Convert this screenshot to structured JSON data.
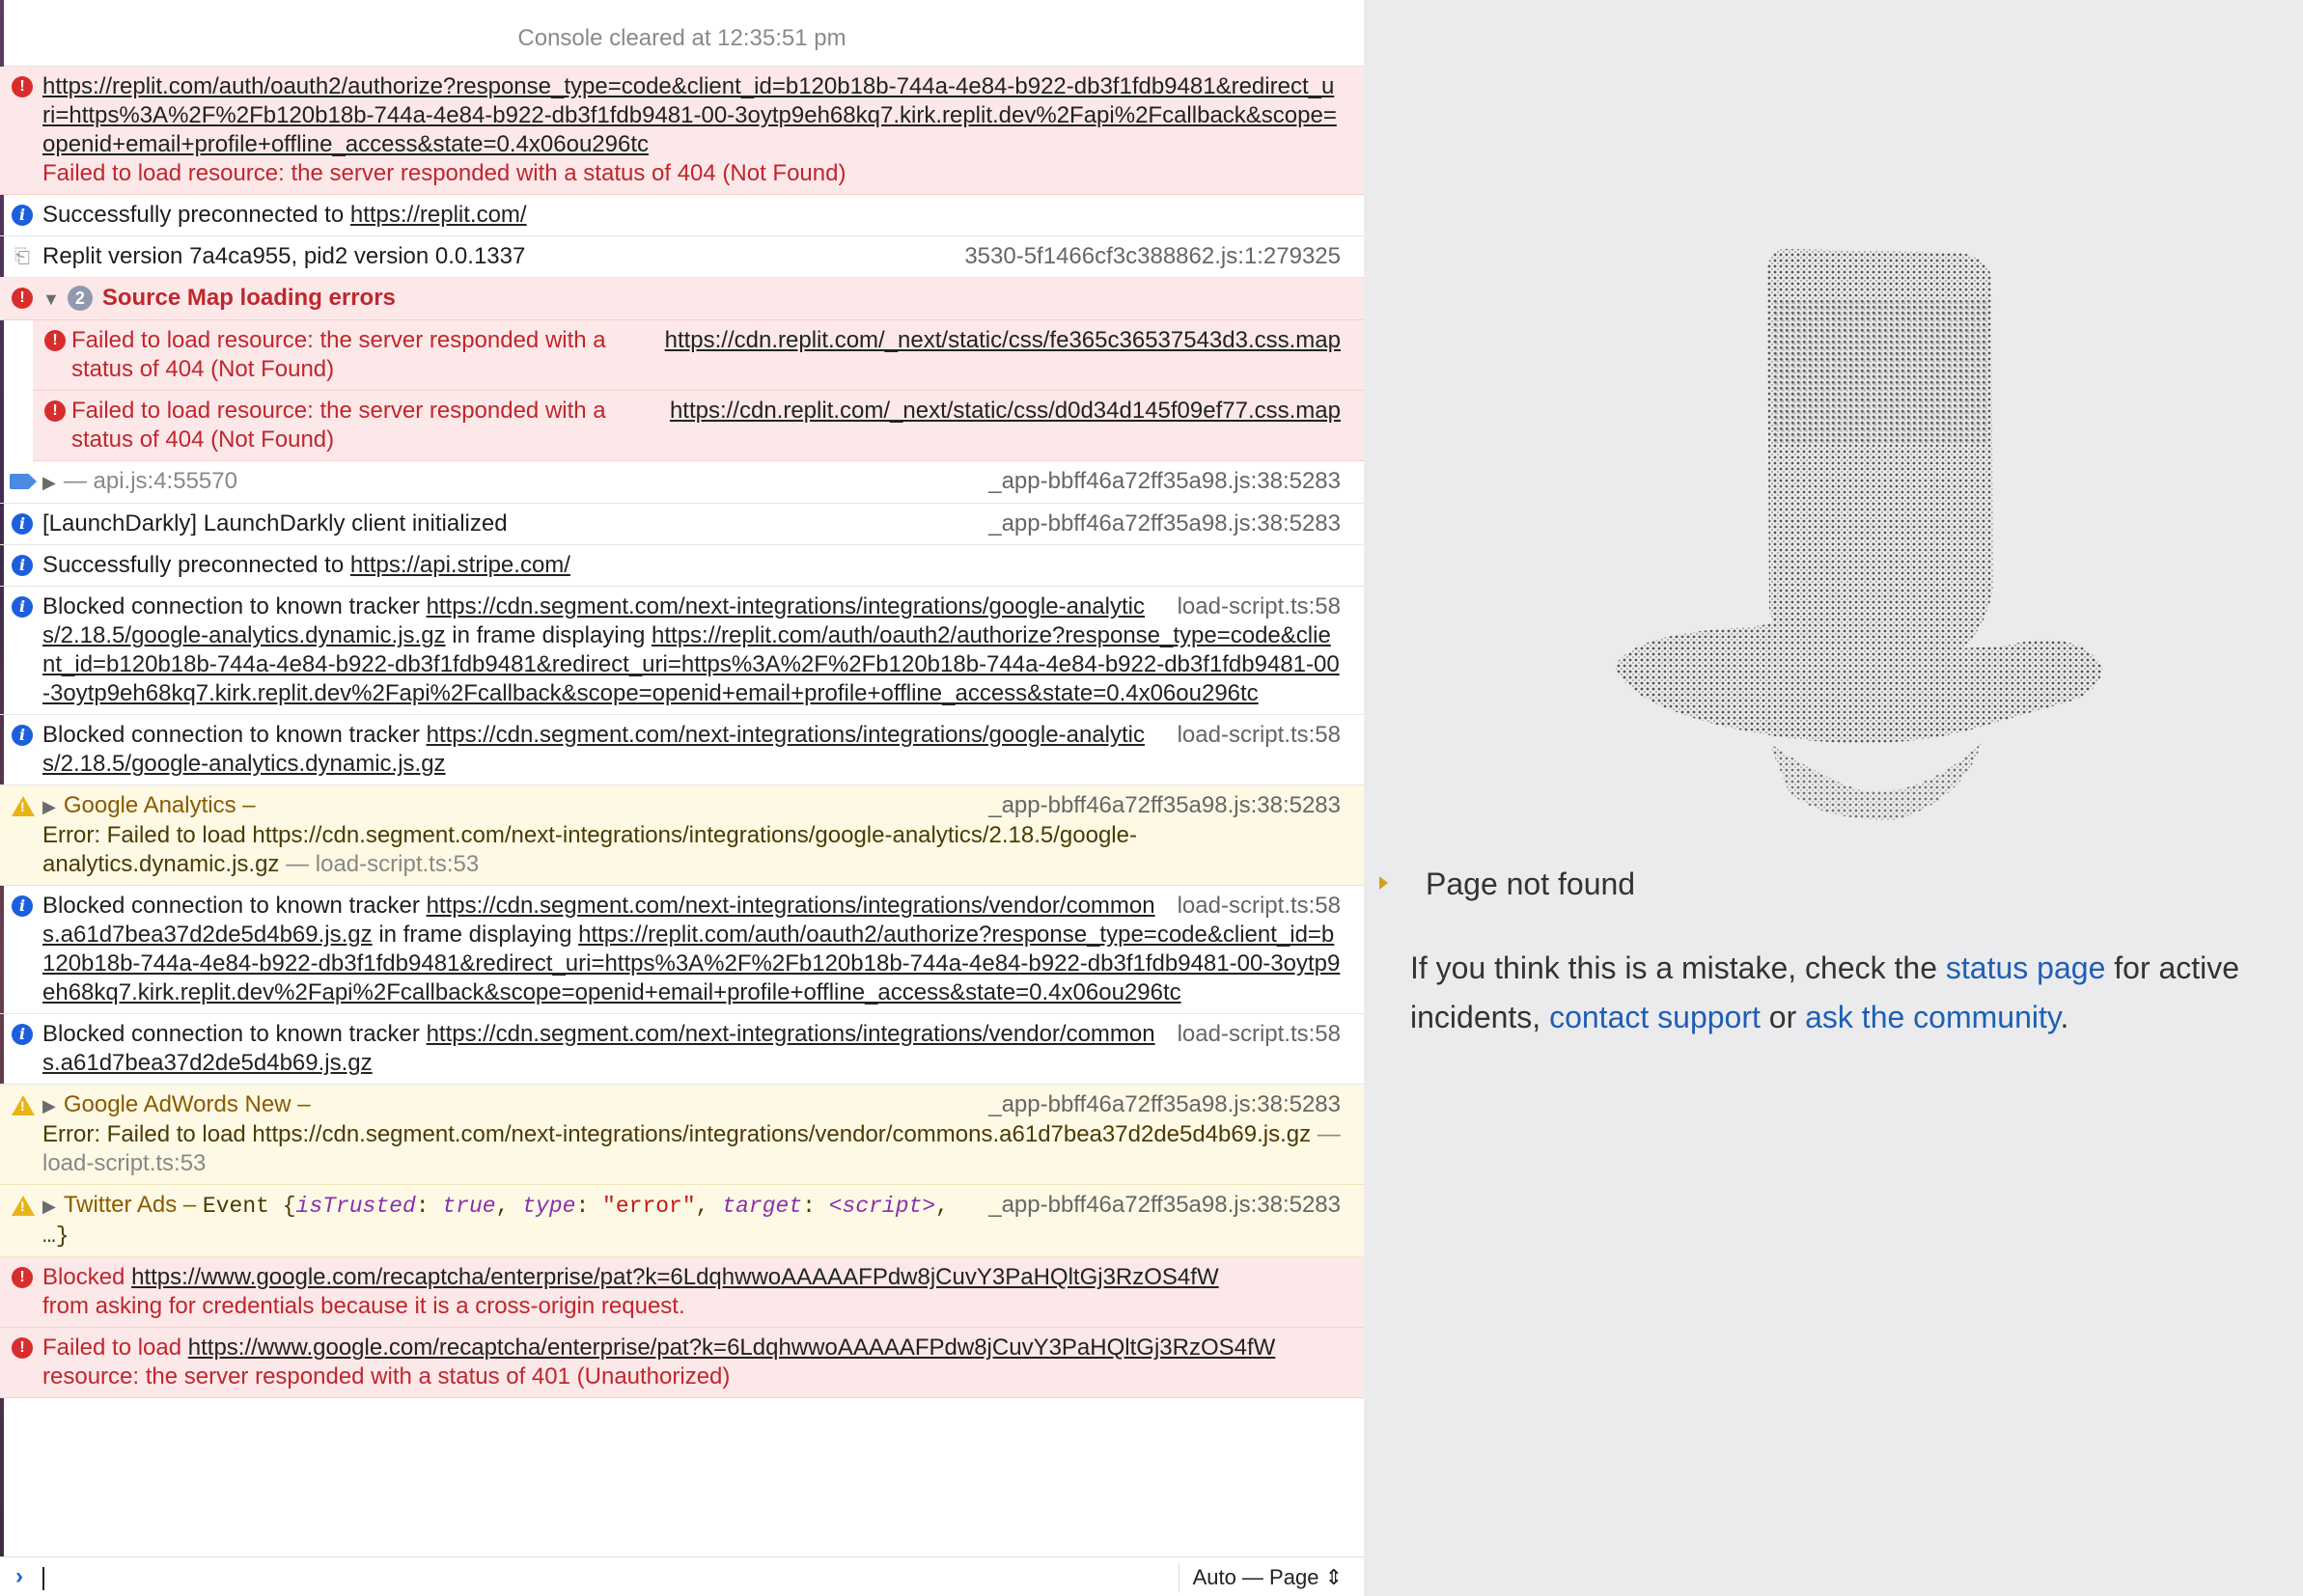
{
  "console": {
    "cleared": "Console cleared at 12:35:51 pm",
    "rows": [
      {
        "link": "https://replit.com/auth/oauth2/authorize?response_type=code&client_id=b120b18b-744a-4e84-b922-db3f1fdb9481&redirect_uri=https%3A%2F%2Fb120b18b-744a-4e84-b922-db3f1fdb9481-00-3oytp9eh68kq7.kirk.replit.dev%2Fapi%2Fcallback&scope=openid+email+profile+offline_access&state=0.4x06ou296tc",
        "msg": "Failed to load resource: the server responded with a status of 404 (Not Found)"
      },
      {
        "text": "Successfully preconnected to",
        "link": "https://replit.com/"
      },
      {
        "text": "Replit version 7a4ca955, pid2 version 0.0.1337",
        "source": "3530-5f1466cf3c388862.js:1:279325"
      },
      {
        "count": "2",
        "title": "Source Map loading errors"
      },
      {
        "msg": "Failed to load resource: the server responded with a status of 404 (Not Found)",
        "link": "https://cdn.replit.com/_next/static/css/fe365c36537543d3.css.map"
      },
      {
        "msg": "Failed to load resource: the server responded with a status of 404 (Not Found)",
        "link": "https://cdn.replit.com/_next/static/css/d0d34d145f09ef77.css.map"
      },
      {
        "text": "— api.js:4:55570",
        "source": "_app-bbff46a72ff35a98.js:38:5283"
      },
      {
        "text": "[LaunchDarkly] LaunchDarkly client initialized",
        "source": "_app-bbff46a72ff35a98.js:38:5283"
      },
      {
        "text": "Successfully preconnected to",
        "link": "https://api.stripe.com/"
      },
      {
        "text": "Blocked connection to known tracker",
        "link": "https://cdn.segment.com/next-integrations/integrations/google-analytics/2.18.5/google-analytics.dynamic.js.gz",
        "mid": "in frame displaying",
        "link2": "https://replit.com/auth/oauth2/authorize?response_type=code&client_id=b120b18b-744a-4e84-b922-db3f1fdb9481&redirect_uri=https%3A%2F%2Fb120b18b-744a-4e84-b922-db3f1fdb9481-00-3oytp9eh68kq7.kirk.replit.dev%2Fapi%2Fcallback&scope=openid+email+profile+offline_access&state=0.4x06ou296tc",
        "source": "load-script.ts:58"
      },
      {
        "text": "Blocked connection to known tracker",
        "link": "https://cdn.segment.com/next-integrations/integrations/google-analytics/2.18.5/google-analytics.dynamic.js.gz",
        "source": "load-script.ts:58"
      },
      {
        "title": "Google Analytics",
        "sep": "–",
        "msg": "Error: Failed to load https://cdn.segment.com/next-integrations/integrations/google-analytics/2.18.5/google-analytics.dynamic.js.gz",
        "tail": "— load-script.ts:53",
        "source": "_app-bbff46a72ff35a98.js:38:5283"
      },
      {
        "text": "Blocked connection to known tracker",
        "link": "https://cdn.segment.com/next-integrations/integrations/vendor/commons.a61d7bea37d2de5d4b69.js.gz",
        "mid": "in frame displaying",
        "link2": "https://replit.com/auth/oauth2/authorize?response_type=code&client_id=b120b18b-744a-4e84-b922-db3f1fdb9481&redirect_uri=https%3A%2F%2Fb120b18b-744a-4e84-b922-db3f1fdb9481-00-3oytp9eh68kq7.kirk.replit.dev%2Fapi%2Fcallback&scope=openid+email+profile+offline_access&state=0.4x06ou296tc",
        "source": "load-script.ts:58"
      },
      {
        "text": "Blocked connection to known tracker",
        "link": "https://cdn.segment.com/next-integrations/integrations/vendor/commons.a61d7bea37d2de5d4b69.js.gz",
        "source": "load-script.ts:58"
      },
      {
        "title": "Google AdWords New",
        "sep": "–",
        "msg": "Error: Failed to load https://cdn.segment.com/next-integrations/integrations/vendor/commons.a61d7bea37d2de5d4b69.js.gz",
        "tail": "— load-script.ts:53",
        "source": "_app-bbff46a72ff35a98.js:38:5283"
      },
      {
        "title": "Twitter Ads",
        "sep": "–",
        "event": "Event {",
        "k1": "isTrusted",
        "v1": "true",
        "k2": "type",
        "v2": "\"error\"",
        "k3": "target",
        "v3": "<script>",
        "more": "…}",
        "source": "_app-bbff46a72ff35a98.js:38:5283"
      },
      {
        "pre": "Blocked",
        "link": "https://www.google.com/recaptcha/enterprise/pat?k=6LdqhwwoAAAAAFPdw8jCuvY3PaHQltGj3RzOS4fW",
        "msg": "from asking for credentials because it is a cross-origin request."
      },
      {
        "pre": "Failed to load",
        "link": "https://www.google.com/recaptcha/enterprise/pat?k=6LdqhwwoAAAAAFPdw8jCuvY3PaHQltGj3RzOS4fW",
        "msg": "resource: the server responded with a status of 401 (Unauthorized)"
      }
    ],
    "prompt": {
      "mode": "Auto — Page"
    }
  },
  "page": {
    "title": "Page not found",
    "text1": "If you think this is a mistake, check the",
    "link1": "status page",
    "text2": "for active incidents,",
    "link2": "contact support",
    "text3": "or",
    "link3": "ask the community",
    "text4": "."
  },
  "colors": {
    "error_bg": "#fce8e8",
    "warn_bg": "#fdf9e4",
    "link_blue": "#1d5fb6",
    "pane_bg": "#ebebed"
  }
}
